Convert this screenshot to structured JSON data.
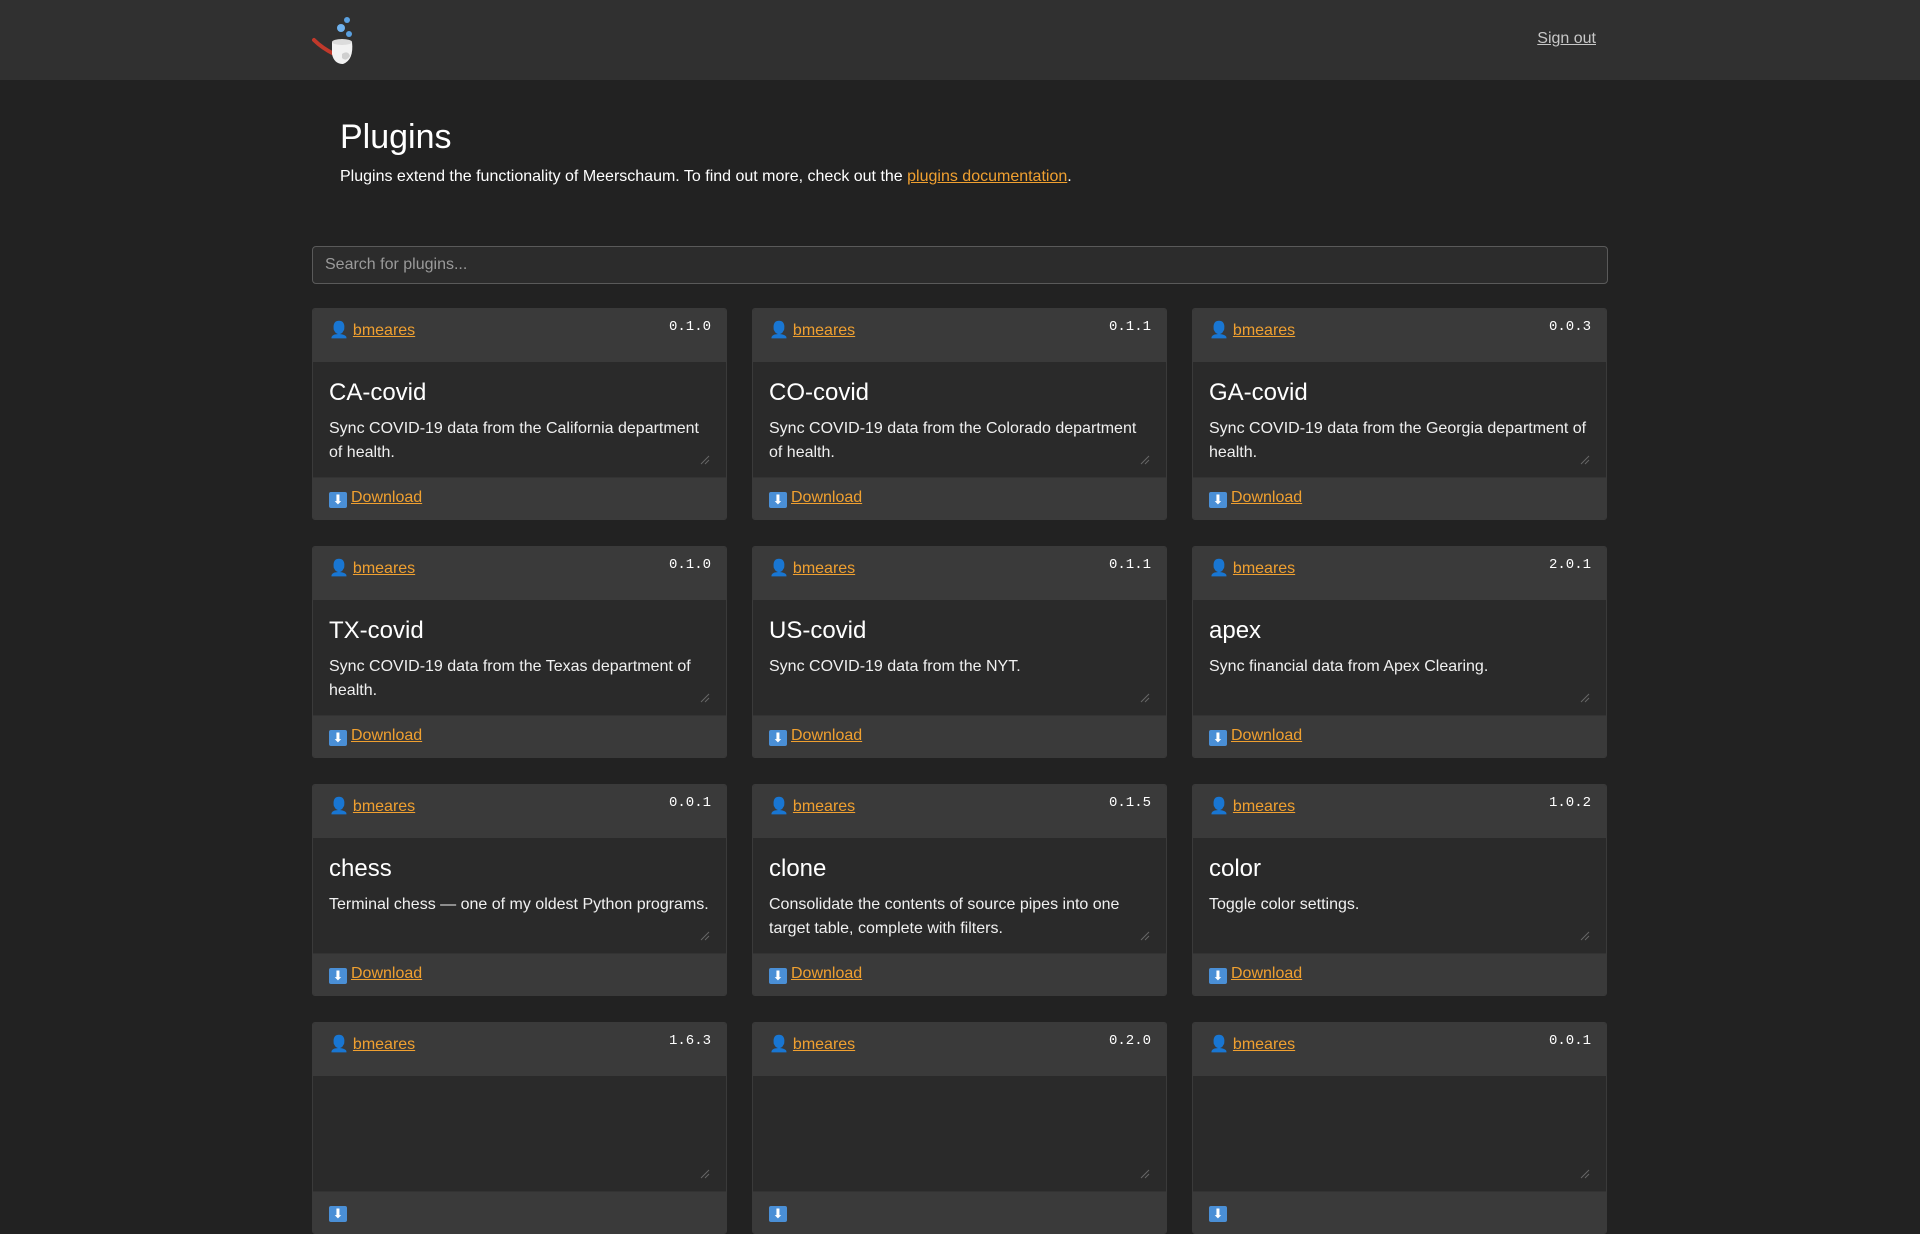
{
  "header": {
    "signout_label": "Sign out"
  },
  "page": {
    "title": "Plugins",
    "intro_before": "Plugins extend the functionality of Meerschaum. To find out more, check out the ",
    "intro_link": "plugins documentation",
    "intro_after": "."
  },
  "search": {
    "placeholder": "Search for plugins...",
    "value": ""
  },
  "plugins": [
    {
      "author": "bmeares",
      "version": "0.1.0",
      "name": "CA-covid",
      "description": "Sync COVID-19 data from the California department of health.",
      "download_label": "Download"
    },
    {
      "author": "bmeares",
      "version": "0.1.1",
      "name": "CO-covid",
      "description": "Sync COVID-19 data from the Colorado department of health.",
      "download_label": "Download"
    },
    {
      "author": "bmeares",
      "version": "0.0.3",
      "name": "GA-covid",
      "description": "Sync COVID-19 data from the Georgia department of health.",
      "download_label": "Download"
    },
    {
      "author": "bmeares",
      "version": "0.1.0",
      "name": "TX-covid",
      "description": "Sync COVID-19 data from the Texas department of health.",
      "download_label": "Download"
    },
    {
      "author": "bmeares",
      "version": "0.1.1",
      "name": "US-covid",
      "description": "Sync COVID-19 data from the NYT.",
      "download_label": "Download"
    },
    {
      "author": "bmeares",
      "version": "2.0.1",
      "name": "apex",
      "description": "Sync financial data from Apex Clearing.",
      "download_label": "Download"
    },
    {
      "author": "bmeares",
      "version": "0.0.1",
      "name": "chess",
      "description": "Terminal chess — one of my oldest Python programs.",
      "download_label": "Download"
    },
    {
      "author": "bmeares",
      "version": "0.1.5",
      "name": "clone",
      "description": "Consolidate the contents of source pipes into one target table, complete with filters.",
      "download_label": "Download"
    },
    {
      "author": "bmeares",
      "version": "1.0.2",
      "name": "color",
      "description": "Toggle color settings.",
      "download_label": "Download"
    },
    {
      "author": "bmeares",
      "version": "1.6.3",
      "name": "",
      "description": "",
      "download_label": ""
    },
    {
      "author": "bmeares",
      "version": "0.2.0",
      "name": "",
      "description": "",
      "download_label": ""
    },
    {
      "author": "bmeares",
      "version": "0.0.1",
      "name": "",
      "description": "",
      "download_label": ""
    }
  ],
  "icons": {
    "author": "person-icon",
    "download": "download-arrow-icon",
    "logo": "meerschaum-pipe-logo",
    "resize": "resize-handle-icon"
  },
  "colors": {
    "link": "#f0a030",
    "background": "#222222",
    "navbar": "#303030",
    "card_header": "#3a3a3a"
  }
}
